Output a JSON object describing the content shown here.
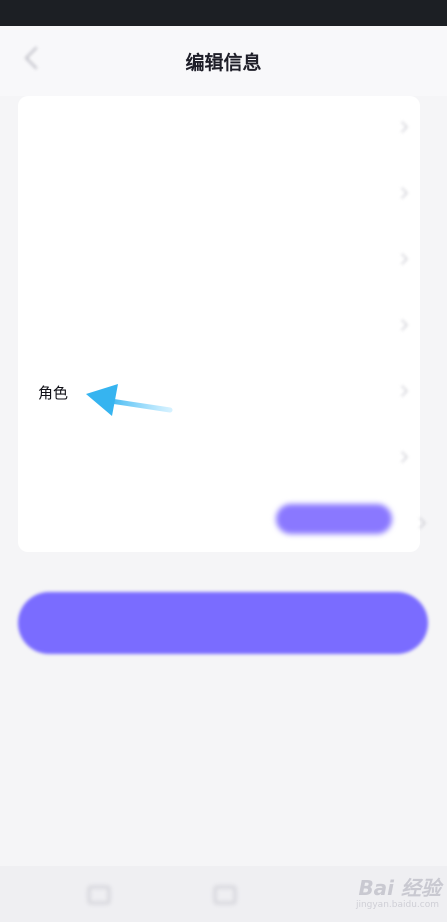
{
  "status_bar": {
    "left_text": "",
    "right_text": ""
  },
  "header": {
    "title": "编辑信息",
    "back_icon": "chevron-left-icon"
  },
  "form": {
    "rows": [
      {
        "label": "",
        "value": ""
      },
      {
        "label": "",
        "value": ""
      },
      {
        "label": "",
        "value": ""
      },
      {
        "label": "",
        "value": ""
      },
      {
        "label": "角色",
        "value": ""
      },
      {
        "label": "",
        "value": ""
      },
      {
        "label": "",
        "pill": ""
      }
    ]
  },
  "save_button": {
    "label": ""
  },
  "annotation": {
    "arrow_color": "#3bb7f0"
  },
  "watermark": {
    "main": "Bai 经验",
    "sub": "jingyan.baidu.com"
  },
  "colors": {
    "accent": "#7a6cff",
    "background": "#f5f5f7"
  }
}
